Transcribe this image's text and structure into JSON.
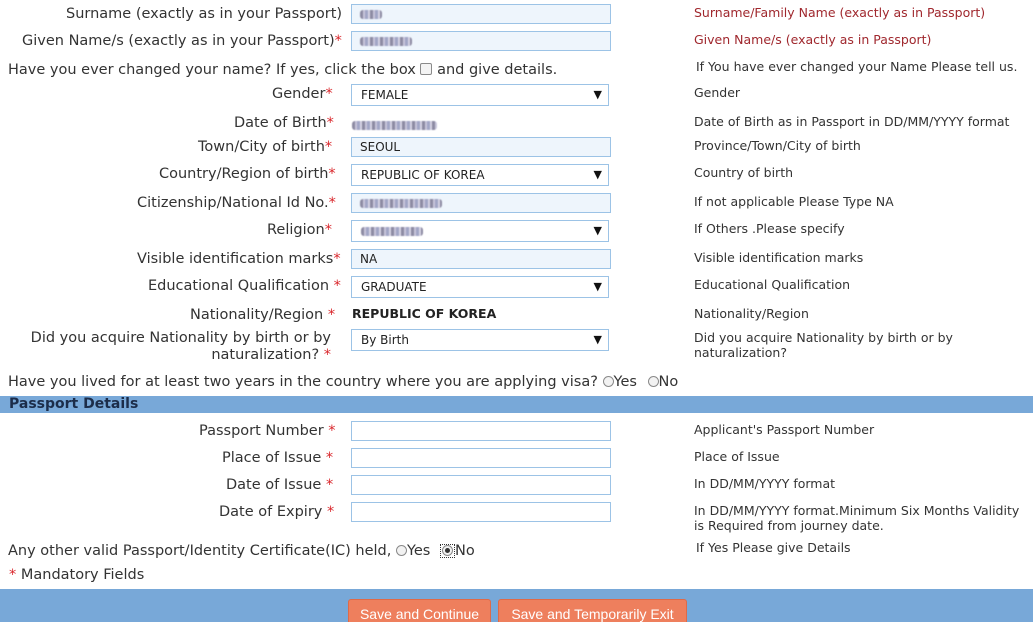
{
  "personal": {
    "surname": {
      "label": "Surname (exactly as in your Passport)",
      "star": "",
      "help": "Surname/Family Name (exactly as in Passport)"
    },
    "given": {
      "label": "Given Name/s (exactly as in your Passport)",
      "star": "*",
      "help": "Given Name/s (exactly as in Passport)"
    },
    "changed": {
      "label": "Have you ever changed your name? If yes, click the box",
      "after": "and give details.",
      "help": "If You have ever changed your Name Please tell us."
    },
    "gender": {
      "label": "Gender",
      "star": "*",
      "value": "FEMALE",
      "help": "Gender"
    },
    "dob": {
      "label": "Date of Birth",
      "star": "*",
      "help": "Date of Birth as in Passport in DD/MM/YYYY format"
    },
    "town": {
      "label": "Town/City of birth",
      "star": "*",
      "value": "SEOUL",
      "help": "Province/Town/City of birth"
    },
    "country": {
      "label": "Country/Region of birth",
      "star": "*",
      "value": "REPUBLIC OF KOREA",
      "help": "Country of birth"
    },
    "citizen_id": {
      "label": "Citizenship/National Id No.",
      "star": "*",
      "help": "If not applicable Please Type NA"
    },
    "religion": {
      "label": "Religion",
      "star": "*",
      "help": "If Others .Please specify"
    },
    "marks": {
      "label": "Visible identification marks",
      "star": "*",
      "value": "NA",
      "help": "Visible identification marks"
    },
    "education": {
      "label": "Educational Qualification",
      "star": "*",
      "value": "GRADUATE",
      "help": "Educational Qualification"
    },
    "nationality": {
      "label": "Nationality/Region",
      "star": "*",
      "value": "REPUBLIC OF KOREA",
      "help": "Nationality/Region"
    },
    "acquire": {
      "label_line1": "Did you acquire Nationality by birth or by",
      "label_line2": "naturalization?",
      "star": "*",
      "value": "By Birth",
      "help_line1": "Did you acquire Nationality by birth or by",
      "help_line2": "naturalization?"
    },
    "lived": {
      "label": "Have you lived for at least two years in the country where you are applying visa?",
      "yes": "Yes",
      "no": "No"
    }
  },
  "passport": {
    "section_title": "Passport Details",
    "number": {
      "label": "Passport Number",
      "star": "*",
      "value": "",
      "help": "Applicant's Passport Number"
    },
    "place": {
      "label": "Place of Issue",
      "star": "*",
      "value": "",
      "help": "Place of Issue"
    },
    "issue_date": {
      "label": "Date of Issue",
      "star": "*",
      "value": "",
      "help": "In DD/MM/YYYY format"
    },
    "expiry": {
      "label": "Date of Expiry",
      "star": "*",
      "value": "",
      "help_line1": "In DD/MM/YYYY format.Minimum Six Months Validity",
      "help_line2": "is Required from journey date."
    },
    "other": {
      "label": "Any other valid Passport/Identity Certificate(IC) held,",
      "yes": "Yes",
      "no": "No",
      "selected": "No",
      "help": "If Yes Please give Details"
    },
    "mandatory_star": "*",
    "mandatory": "Mandatory Fields"
  },
  "footer": {
    "save_continue": "Save and Continue",
    "save_exit": "Save and Temporarily Exit"
  },
  "colors": {
    "accent_bar": "#78a8d8",
    "button": "#ee7f5d",
    "required": "#d9262b",
    "help_red": "#a0282e"
  }
}
